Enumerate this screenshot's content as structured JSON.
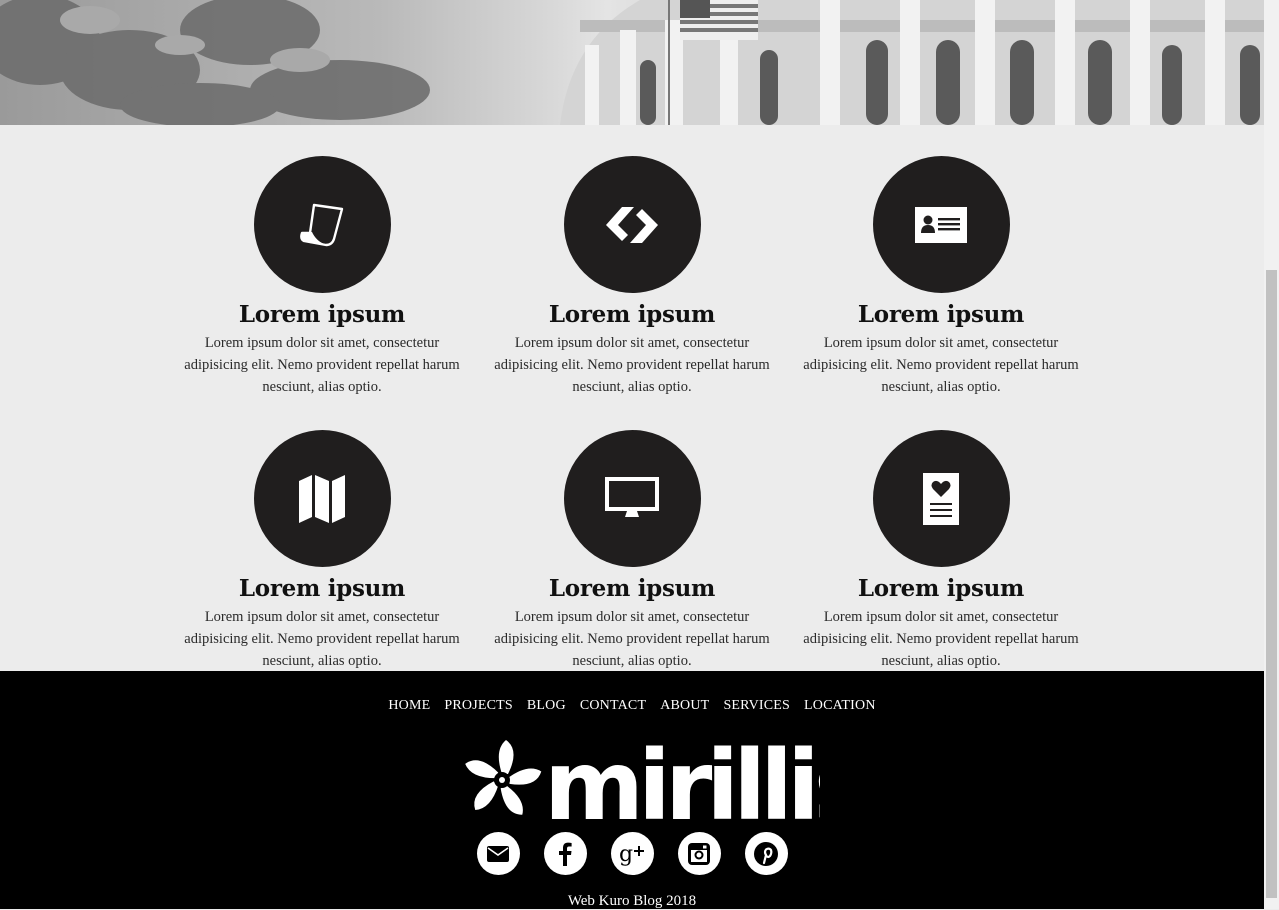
{
  "features": [
    {
      "icon": "page-curl-icon",
      "title": "Lorem ipsum",
      "text": "Lorem ipsum dolor sit amet, consectetur adipisicing elit. Nemo provident repellat harum nesciunt, alias optio."
    },
    {
      "icon": "link-chain-icon",
      "title": "Lorem ipsum",
      "text": "Lorem ipsum dolor sit amet, consectetur adipisicing elit. Nemo provident repellat harum nesciunt, alias optio."
    },
    {
      "icon": "id-card-icon",
      "title": "Lorem ipsum",
      "text": "Lorem ipsum dolor sit amet, consectetur adipisicing elit. Nemo provident repellat harum nesciunt, alias optio."
    },
    {
      "icon": "map-icon",
      "title": "Lorem ipsum",
      "text": "Lorem ipsum dolor sit amet, consectetur adipisicing elit. Nemo provident repellat harum nesciunt, alias optio."
    },
    {
      "icon": "monitor-icon",
      "title": "Lorem ipsum",
      "text": "Lorem ipsum dolor sit amet, consectetur adipisicing elit. Nemo provident repellat harum nesciunt, alias optio."
    },
    {
      "icon": "heart-document-icon",
      "title": "Lorem ipsum",
      "text": "Lorem ipsum dolor sit amet, consectetur adipisicing elit. Nemo provident repellat harum nesciunt, alias optio."
    }
  ],
  "footer": {
    "nav": [
      "HOME",
      "PROJECTS",
      "BLOG",
      "CONTACT",
      "ABOUT",
      "SERVICES",
      "LOCATION"
    ],
    "logo_text": "mirillis",
    "socials": [
      "email-icon",
      "facebook-icon",
      "google-plus-icon",
      "instagram-icon",
      "pinterest-icon"
    ],
    "copyright": "Web Kuro Blog 2018"
  },
  "colors": {
    "page_bg": "#ececec",
    "circle": "#201e1e",
    "footer_bg": "#000000"
  }
}
